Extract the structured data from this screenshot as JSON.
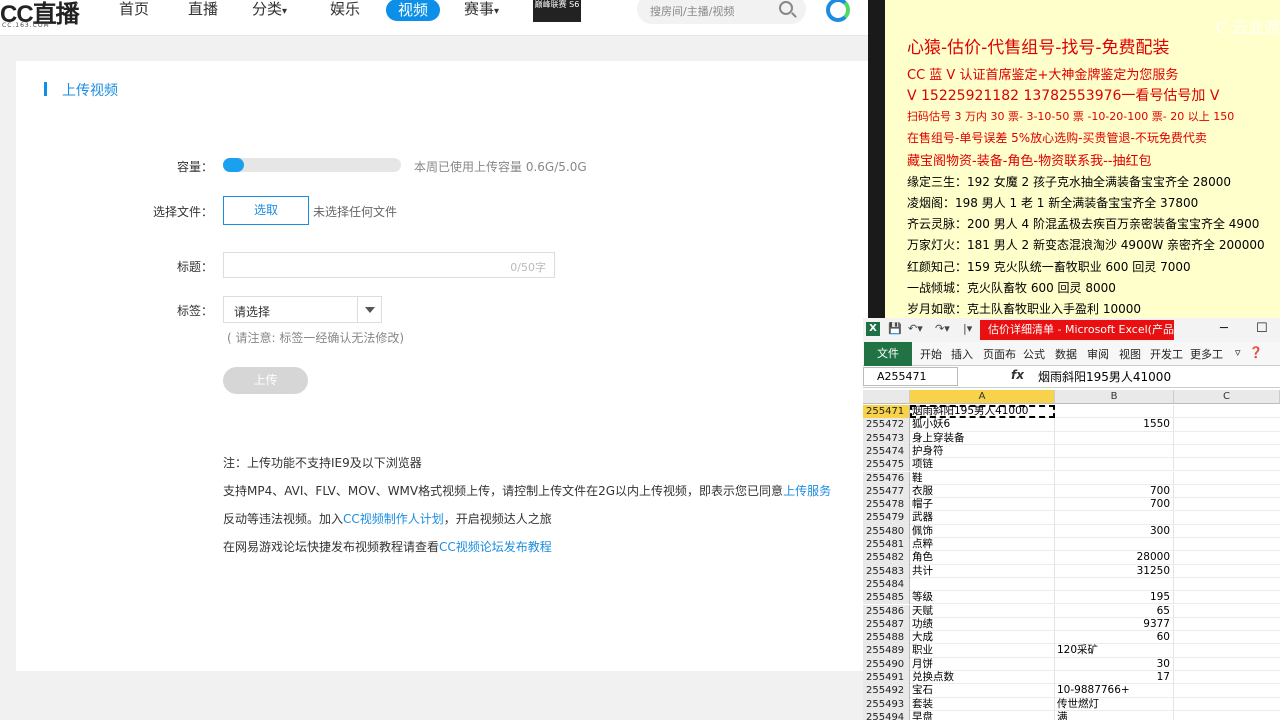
{
  "site": {
    "logo": "CC直播",
    "logo_sub": "CC.163.COM",
    "nav": [
      "首页",
      "直播",
      "分类",
      "娱乐",
      "视频",
      "赛事"
    ],
    "nav_badge": "巅峰联赛 S6",
    "search_placeholder": "搜房间/主播/视频"
  },
  "upload": {
    "section_title": "上传视频",
    "capacity_label": "容量：",
    "capacity_fraction": 0.12,
    "capacity_text": "本周已使用上传容量 0.6G/5.0G",
    "file_label": "选择文件：",
    "pick_button": "选取",
    "no_file_text": "未选择任何文件",
    "title_label": "标题：",
    "title_counter": "0/50字",
    "tag_label": "标签：",
    "tag_select": "请选择",
    "tag_note": "( 请注意: 标签一经确认无法修改)",
    "upload_button": "上传",
    "notes": {
      "n1": "注：上传功能不支持IE9及以下浏览器",
      "n2a": "支持MP4、AVI、FLV、MOV、WMV格式视频上传，请控制上传文件在2G以内上传视频，即表示您已同意",
      "n2b": "上传服务",
      "n3a": "反动等违法视频。加入",
      "n3b": "CC视频制作人计划",
      "n3c": "，开启视频达人之旅",
      "n4a": "在网易游戏论坛快捷发布视频教程请查看",
      "n4b": "CC视频论坛发布教程"
    }
  },
  "ad": {
    "watermark": "C 云业游",
    "lines": [
      "心猿-估价-代售组号-找号-免费配装",
      "CC 蓝 V 认证首席鉴定+大神金牌鉴定为您服务",
      "V 15225921182      13782553976一看号估号加 V",
      "扫码估号 3 万内 30 票- 3-10-50 票  -10-20-100 票- 20 以上 150",
      "在售组号-单号误差 5%放心选购-买贵管退-不玩免费代卖",
      "藏宝阁物资-装备-角色-物资联系我--抽红包",
      "缘定三生：192 女魔 2 孩子克水抽全满装备宝宝齐全 28000",
      "凌烟阁：198 男人 1 老 1 新全满装备宝宝齐全 37800",
      "齐云灵脉：200 男人 4 阶混孟极去疾百万亲密装备宝宝齐全 4900",
      "万家灯火：181 男人 2 新变态混浪淘沙 4900W 亲密齐全 200000",
      "红颜知己：159 克火队统一畜牧职业 600 回灵 7000",
      "一战倾城：克火队畜牧 600 回灵 8000",
      "岁月如歌：克土队畜牧职业入手盈利 10000"
    ]
  },
  "excel": {
    "title": "估价详细清单 - Microsoft Excel(产品...",
    "tabs": [
      "文件",
      "开始",
      "插入",
      "页面布",
      "公式",
      "数据",
      "审阅",
      "视图",
      "开发工",
      "更多工"
    ],
    "name_box": "A255471",
    "fx": "fx",
    "formula": "烟雨斜阳195男人41000",
    "columns": [
      "A",
      "B",
      "C"
    ],
    "rows": [
      {
        "n": "255471",
        "a": "烟雨斜阳195男人41000",
        "b": ""
      },
      {
        "n": "255472",
        "a": "狐小妖6",
        "b": "1550"
      },
      {
        "n": "255473",
        "a": "身上穿装备",
        "b": ""
      },
      {
        "n": "255474",
        "a": "护身符",
        "b": ""
      },
      {
        "n": "255475",
        "a": "项链",
        "b": ""
      },
      {
        "n": "255476",
        "a": "鞋",
        "b": ""
      },
      {
        "n": "255477",
        "a": "衣服",
        "b": "700"
      },
      {
        "n": "255478",
        "a": "帽子",
        "b": "700"
      },
      {
        "n": "255479",
        "a": "武器",
        "b": ""
      },
      {
        "n": "255480",
        "a": "佩饰",
        "b": "300"
      },
      {
        "n": "255481",
        "a": "点粹",
        "b": ""
      },
      {
        "n": "255482",
        "a": "角色",
        "b": "28000"
      },
      {
        "n": "255483",
        "a": "共计",
        "b": "31250"
      },
      {
        "n": "255484",
        "a": "",
        "b": ""
      },
      {
        "n": "255485",
        "a": "等级",
        "b": "195"
      },
      {
        "n": "255486",
        "a": "天赋",
        "b": "65"
      },
      {
        "n": "255487",
        "a": "功绩",
        "b": "9377"
      },
      {
        "n": "255488",
        "a": "大成",
        "b": "60"
      },
      {
        "n": "255489",
        "a": "职业",
        "b": "120采矿"
      },
      {
        "n": "255490",
        "a": "月饼",
        "b": "30"
      },
      {
        "n": "255491",
        "a": "兑换点数",
        "b": "17"
      },
      {
        "n": "255492",
        "a": "宝石",
        "b": "10-9887766+"
      },
      {
        "n": "255493",
        "a": "套装",
        "b": "传世燃灯"
      },
      {
        "n": "255494",
        "a": "早盘",
        "b": "满"
      }
    ]
  }
}
